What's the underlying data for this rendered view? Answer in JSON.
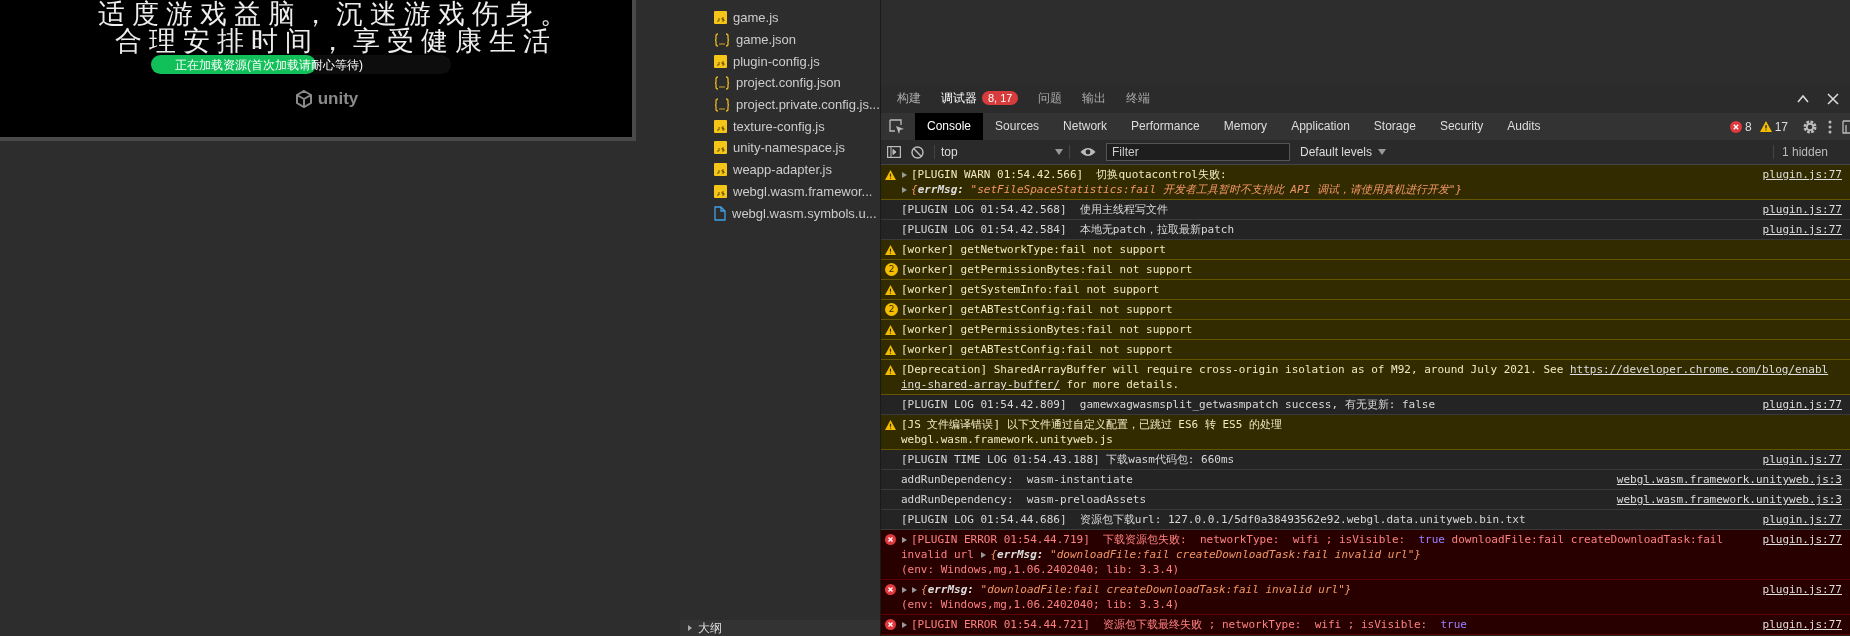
{
  "game": {
    "notice_lines": [
      "适度游戏益脑，沉迷游戏伤身。",
      "合理安排时间，享受健康生活"
    ],
    "loading": {
      "label": "正在加载资源(首次加载请耐心等待)",
      "level": 0.55
    },
    "engine_label": "unity"
  },
  "files": [
    {
      "name": "game.js",
      "kind": "js"
    },
    {
      "name": "game.json",
      "kind": "json"
    },
    {
      "name": "plugin-config.js",
      "kind": "js"
    },
    {
      "name": "project.config.json",
      "kind": "json"
    },
    {
      "name": "project.private.config.js...",
      "kind": "json"
    },
    {
      "name": "texture-config.js",
      "kind": "js"
    },
    {
      "name": "unity-namespace.js",
      "kind": "js"
    },
    {
      "name": "weapp-adapter.js",
      "kind": "js"
    },
    {
      "name": "webgl.wasm.framewor...",
      "kind": "js"
    },
    {
      "name": "webgl.wasm.symbols.u...",
      "kind": "file"
    }
  ],
  "outline": {
    "label": "大纲",
    "expanded": false
  },
  "panel_tabs": [
    {
      "label": "构建",
      "selected": false
    },
    {
      "label": "调试器",
      "selected": true,
      "badge": "8, 17"
    },
    {
      "label": "问题",
      "selected": false
    },
    {
      "label": "输出",
      "selected": false
    },
    {
      "label": "终端",
      "selected": false
    }
  ],
  "devtools_tabs": [
    {
      "label": "Console",
      "selected": true
    },
    {
      "label": "Sources",
      "selected": false
    },
    {
      "label": "Network",
      "selected": false
    },
    {
      "label": "Performance",
      "selected": false
    },
    {
      "label": "Memory",
      "selected": false
    },
    {
      "label": "Application",
      "selected": false
    },
    {
      "label": "Storage",
      "selected": false
    },
    {
      "label": "Security",
      "selected": false
    },
    {
      "label": "Audits",
      "selected": false
    }
  ],
  "counts": {
    "errors": "8",
    "warnings": "17"
  },
  "toolbar": {
    "context": "top",
    "filter_placeholder": "Filter",
    "levels": "Default levels",
    "hidden": "1 hidden"
  },
  "console": [
    {
      "kind": "warn",
      "source": "plugin.js:77",
      "lines": [
        [
          {
            "kind": "toggle"
          },
          {
            "text": "[PLUGIN WARN 01:54.42.566]  切换quotacontrol失败:"
          }
        ],
        [
          {
            "kind": "toggle"
          },
          {
            "kind": "object",
            "text": "{**errMsg:** \"setFileSpaceStatistics:fail 开发者工具暂时不支持此 API 调试，请使用真机进行开发\"}"
          }
        ]
      ]
    },
    {
      "kind": "log",
      "source": "plugin.js:77",
      "lines": [
        [
          {
            "text": "[PLUGIN LOG 01:54.42.568]  使用主线程写文件"
          }
        ]
      ]
    },
    {
      "kind": "log",
      "source": "plugin.js:77",
      "lines": [
        [
          {
            "text": "[PLUGIN LOG 01:54.42.584]  本地无patch，拉取最新patch"
          }
        ]
      ]
    },
    {
      "kind": "warn",
      "lines": [
        [
          {
            "text": "[worker] getNetworkType:fail not support"
          }
        ]
      ]
    },
    {
      "kind": "warn",
      "count": "2",
      "lines": [
        [
          {
            "text": "[worker] getPermissionBytes:fail not support"
          }
        ]
      ]
    },
    {
      "kind": "warn",
      "lines": [
        [
          {
            "text": "[worker] getSystemInfo:fail not support"
          }
        ]
      ]
    },
    {
      "kind": "warn",
      "count": "2",
      "lines": [
        [
          {
            "text": "[worker] getABTestConfig:fail not support"
          }
        ]
      ]
    },
    {
      "kind": "warn",
      "lines": [
        [
          {
            "text": "[worker] getPermissionBytes:fail not support"
          }
        ]
      ]
    },
    {
      "kind": "warn",
      "lines": [
        [
          {
            "text": "[worker] getABTestConfig:fail not support"
          }
        ]
      ]
    },
    {
      "kind": "warn",
      "lines": [
        [
          {
            "text": "[Deprecation] SharedArrayBuffer will require cross-origin isolation as of M92, around July 2021. See "
          },
          {
            "kind": "link",
            "text": "https://developer.chrome.com/blog/enabl"
          }
        ],
        [
          {
            "kind": "link",
            "text": "ing-shared-array-buffer/"
          },
          {
            "text": " for more details."
          }
        ]
      ]
    },
    {
      "kind": "log",
      "source": "plugin.js:77",
      "lines": [
        [
          {
            "text": "[PLUGIN LOG 01:54.42.809]  gamewxagwasmsplit_getwasmpatch success, 有无更新: false"
          }
        ]
      ]
    },
    {
      "kind": "warn",
      "lines": [
        [
          {
            "text": "[JS 文件编译错误] 以下文件通过自定义配置，已跳过 ES6 转 ES5 的处理"
          }
        ],
        [
          {
            "text": "webgl.wasm.framework.unityweb.js"
          }
        ]
      ]
    },
    {
      "kind": "log",
      "source": "plugin.js:77",
      "lines": [
        [
          {
            "text": "[PLUGIN TIME LOG 01:54.43.188] 下载wasm代码包: 660ms"
          }
        ]
      ]
    },
    {
      "kind": "log",
      "source": "webgl.wasm.framework.unityweb.js:3",
      "lines": [
        [
          {
            "text": "addRunDependency:  wasm-instantiate"
          }
        ]
      ]
    },
    {
      "kind": "log",
      "source": "webgl.wasm.framework.unityweb.js:3",
      "lines": [
        [
          {
            "text": "addRunDependency:  wasm-preloadAssets"
          }
        ]
      ]
    },
    {
      "kind": "log",
      "source": "plugin.js:77",
      "lines": [
        [
          {
            "text": "[PLUGIN LOG 01:54.44.686]  资源包下载url: 127.0.0.1/5df0a38493562e92.webgl.data.unityweb.bin.txt"
          }
        ]
      ]
    },
    {
      "kind": "error",
      "source": "plugin.js:77",
      "lines": [
        [
          {
            "kind": "toggle"
          },
          {
            "text": "[PLUGIN ERROR 01:54.44.719]  下载资源包失败:  networkType:  wifi ; isVisible:  "
          },
          {
            "kind": "bool",
            "text": "true"
          },
          {
            "text": " downloadFile:fail createDownloadTask:fail"
          }
        ],
        [
          {
            "text": "invalid url "
          },
          {
            "kind": "toggle"
          },
          {
            "kind": "object",
            "text": "{**errMsg:** \"downloadFile:fail createDownloadTask:fail invalid url\"}"
          }
        ],
        [
          {
            "text": "(env: Windows,mg,1.06.2402040; lib: 3.3.4)"
          }
        ]
      ]
    },
    {
      "kind": "error",
      "source": "plugin.js:77",
      "lines": [
        [
          {
            "kind": "toggle"
          },
          {
            "kind": "toggle"
          },
          {
            "kind": "object",
            "text": "{**errMsg:** \"downloadFile:fail createDownloadTask:fail invalid url\"}"
          }
        ],
        [
          {
            "text": "(env: Windows,mg,1.06.2402040; lib: 3.3.4)"
          }
        ]
      ]
    },
    {
      "kind": "error",
      "source": "plugin.js:77",
      "lines": [
        [
          {
            "kind": "toggle"
          },
          {
            "text": "[PLUGIN ERROR 01:54.44.721]  资源包下载最终失败 ; networkType:  wifi ; isVisible:  "
          },
          {
            "kind": "bool",
            "text": "true"
          }
        ]
      ]
    }
  ]
}
